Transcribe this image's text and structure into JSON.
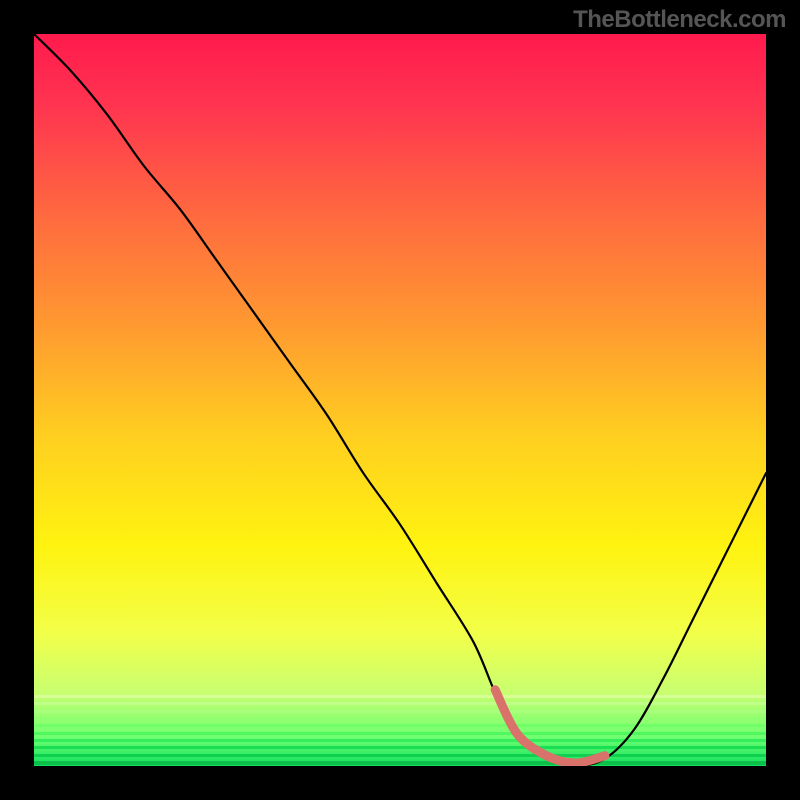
{
  "branding": {
    "watermark": "TheBottleneck.com"
  },
  "chart_data": {
    "type": "line",
    "title": "",
    "xlabel": "",
    "ylabel": "",
    "x_range": [
      0,
      100
    ],
    "y_range": [
      0,
      100
    ],
    "notes": "Bottleneck percentage curve. Background hue encodes severity (green=low near bottom, red=high near top). Curve shows bottleneck % across a parameter sweep; minimum ~0% around x≈66–78. Axis ticks/numbers are not rendered in source image.",
    "series": [
      {
        "name": "bottleneck-curve",
        "x": [
          0,
          5,
          10,
          15,
          20,
          25,
          30,
          35,
          40,
          45,
          50,
          55,
          60,
          63,
          66,
          70,
          74,
          78,
          82,
          86,
          90,
          94,
          98,
          100
        ],
        "y": [
          100,
          95,
          89,
          82,
          76,
          69,
          62,
          55,
          48,
          40,
          33,
          25,
          17,
          10,
          4,
          1,
          0,
          1,
          5,
          12,
          20,
          28,
          36,
          40
        ]
      }
    ],
    "optimum_marker": {
      "x_start": 63,
      "x_end": 79,
      "color": "#d9726b"
    },
    "gradient_stops": [
      {
        "pos": 0.0,
        "color": "#ff1a4d"
      },
      {
        "pos": 0.1,
        "color": "#ff3550"
      },
      {
        "pos": 0.25,
        "color": "#ff6a3f"
      },
      {
        "pos": 0.4,
        "color": "#ff9a30"
      },
      {
        "pos": 0.55,
        "color": "#ffcf20"
      },
      {
        "pos": 0.7,
        "color": "#fff310"
      },
      {
        "pos": 0.82,
        "color": "#f2ff4a"
      },
      {
        "pos": 0.9,
        "color": "#c8ff70"
      },
      {
        "pos": 0.96,
        "color": "#70ff70"
      },
      {
        "pos": 1.0,
        "color": "#10e060"
      }
    ],
    "green_band_lines": [
      {
        "y": 0.905,
        "color": "#d8ff95",
        "h": 3
      },
      {
        "y": 0.915,
        "color": "#c0ff8a",
        "h": 3
      },
      {
        "y": 0.925,
        "color": "#a8ff7d",
        "h": 3
      },
      {
        "y": 0.935,
        "color": "#90ff70",
        "h": 3
      },
      {
        "y": 0.945,
        "color": "#70ff68",
        "h": 3
      },
      {
        "y": 0.955,
        "color": "#50f860",
        "h": 3
      },
      {
        "y": 0.965,
        "color": "#34ee5c",
        "h": 3
      },
      {
        "y": 0.975,
        "color": "#1adf55",
        "h": 3
      },
      {
        "y": 0.985,
        "color": "#10d050",
        "h": 3
      },
      {
        "y": 0.996,
        "color": "#0bbf48",
        "h": 4
      }
    ]
  }
}
